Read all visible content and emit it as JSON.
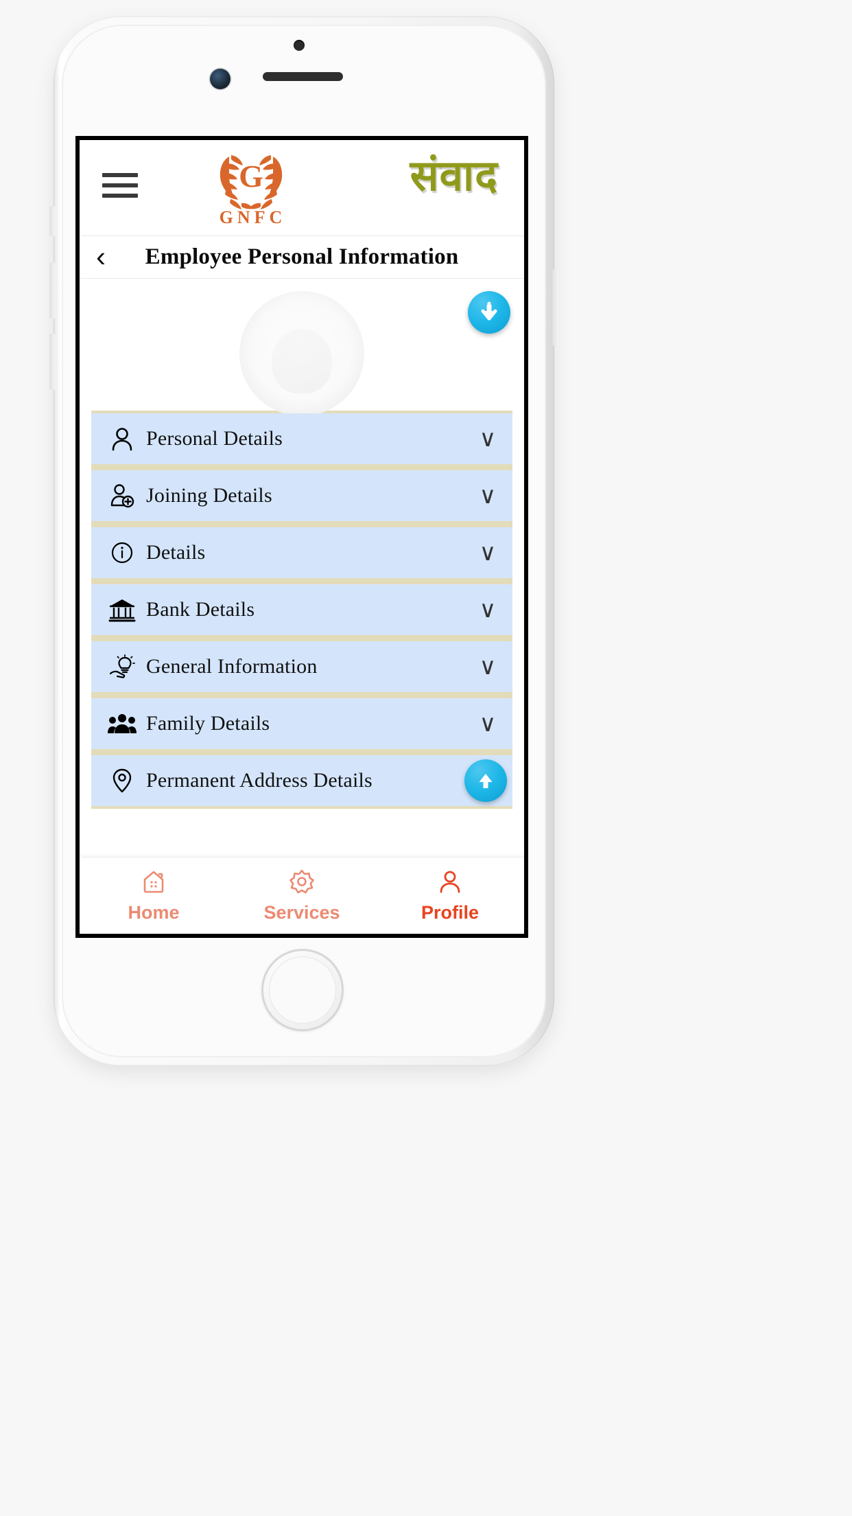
{
  "device": {
    "type": "smartphone-mockup",
    "chrome": {
      "camera": "front-camera",
      "earpiece": "earpiece-speaker",
      "home_button": "home-button"
    }
  },
  "header": {
    "menu_icon": "hamburger-menu-icon",
    "logo": {
      "letter": "G",
      "wordmark": "GNFC",
      "mark": "laurel-wreath-logo",
      "color": "#D9672B"
    },
    "brand_script": "संवाद",
    "brand_script_color": "#8f9a1b"
  },
  "title_bar": {
    "back_icon": "back-chevron-icon",
    "title": "Employee Personal Information"
  },
  "photo": {
    "avatar": "employee-photo-placeholder",
    "scroll_down_button": {
      "icon": "arrow-down-icon",
      "color": "#1eb7e8"
    }
  },
  "accordion": {
    "row_bg": "#d4e5fb",
    "divider_bg": "#e2dcba",
    "items": [
      {
        "label": "Personal Details",
        "icon": "user-icon",
        "chevron": "∨"
      },
      {
        "label": "Joining Details",
        "icon": "user-add-icon",
        "chevron": "∨"
      },
      {
        "label": "Details",
        "icon": "info-circle-icon",
        "chevron": "∨"
      },
      {
        "label": "Bank Details",
        "icon": "bank-icon",
        "chevron": "∨"
      },
      {
        "label": "General Information",
        "icon": "hand-bulb-icon",
        "chevron": "∨"
      },
      {
        "label": "Family Details",
        "icon": "family-group-icon",
        "chevron": "∨"
      },
      {
        "label": "Permanent Address Details",
        "icon": "location-pin-icon",
        "chevron": ""
      }
    ],
    "scroll_up_button": {
      "icon": "arrow-up-icon",
      "color": "#1eb7e8"
    }
  },
  "bottom_nav": {
    "active_color": "#E8431F",
    "inactive_color": "#EC8A72",
    "items": [
      {
        "label": "Home",
        "icon": "home-icon",
        "active": false
      },
      {
        "label": "Services",
        "icon": "gear-icon",
        "active": false
      },
      {
        "label": "Profile",
        "icon": "profile-icon",
        "active": true
      }
    ]
  }
}
